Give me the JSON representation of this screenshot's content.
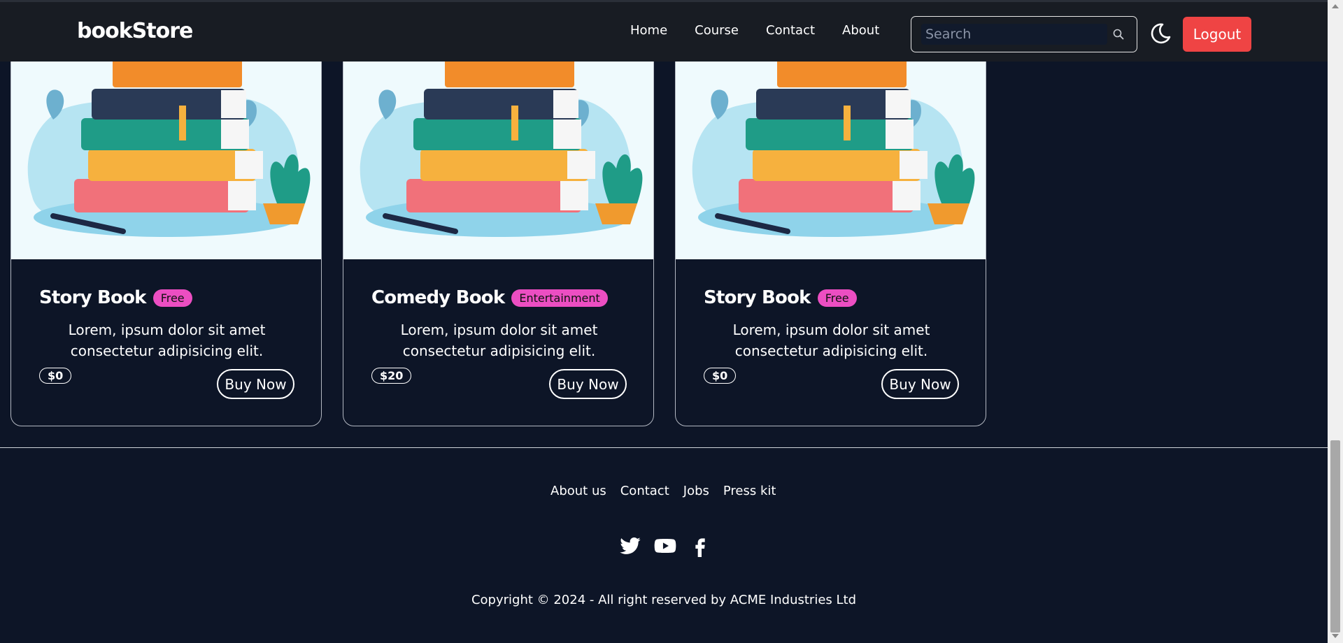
{
  "navbar": {
    "brand": "bookStore",
    "links": [
      "Home",
      "Course",
      "Contact",
      "About"
    ],
    "search_placeholder": "Search",
    "logout_label": "Logout"
  },
  "cards": [
    {
      "title": "Story Book",
      "badge": "Free",
      "description": "Lorem, ipsum dolor sit amet consectetur adipisicing elit.",
      "price": "$0",
      "buy_label": "Buy Now"
    },
    {
      "title": "Comedy Book",
      "badge": "Entertainment",
      "description": "Lorem, ipsum dolor sit amet consectetur adipisicing elit.",
      "price": "$20",
      "buy_label": "Buy Now"
    },
    {
      "title": "Story Book",
      "badge": "Free",
      "description": "Lorem, ipsum dolor sit amet consectetur adipisicing elit.",
      "price": "$0",
      "buy_label": "Buy Now"
    }
  ],
  "footer": {
    "links": [
      "About us",
      "Contact",
      "Jobs",
      "Press kit"
    ],
    "social_icons": [
      "twitter-icon",
      "youtube-icon",
      "facebook-icon"
    ],
    "copyright": "Copyright © 2024 - All right reserved by ACME Industries Ltd"
  },
  "colors": {
    "background": "#0d1527",
    "navbar": "#181c23",
    "logout": "#ef4444",
    "badge": "#ec4ec2",
    "card_image_bg": "#effafd"
  }
}
